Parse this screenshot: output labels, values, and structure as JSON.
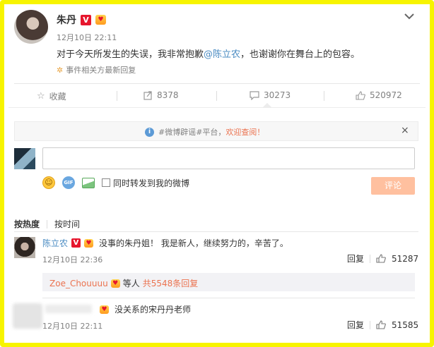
{
  "post": {
    "author": "朱丹",
    "v_badge": "V",
    "time": "12月10日 22:11",
    "text_before": "对于今天所发生的失误，我非常抱歉",
    "mention": "@陈立农",
    "text_after": "，也谢谢你在舞台上的包容。",
    "event_link": "事件相关方最新回复"
  },
  "actions": {
    "favorite_label": "收藏",
    "repost_count": "8378",
    "comment_count": "30273",
    "like_count": "520972"
  },
  "notice": {
    "text": "#微博辟谣#平台，",
    "link": "欢迎查阅！",
    "close": "×"
  },
  "composer": {
    "placeholder": "",
    "repost_checkbox_label": "同时转发到我的微博",
    "submit_label": "评论"
  },
  "sort_tabs": {
    "hot": "按热度",
    "time": "按时间"
  },
  "comments": [
    {
      "author": "陈立农",
      "v_badge": "V",
      "text": "没事的朱丹姐！ 我是新人，继续努力的，辛苦了。",
      "time": "12月10日 22:36",
      "reply_label": "回复",
      "likes": "51287",
      "sub_reply": {
        "author": "Zoe_Chouuuu",
        "text": "等人",
        "count_link": "共5548条回复"
      }
    },
    {
      "author": "",
      "text": "没关系的宋丹丹老师",
      "time": "12月10日 22:11",
      "reply_label": "回复",
      "likes": "51585"
    }
  ],
  "colors": {
    "frame": "#f7f400",
    "orange_link": "#eb7350",
    "blue_link": "#4a8bc2",
    "vip_red": "#e6162d",
    "submit_bg": "#ffc09f"
  }
}
